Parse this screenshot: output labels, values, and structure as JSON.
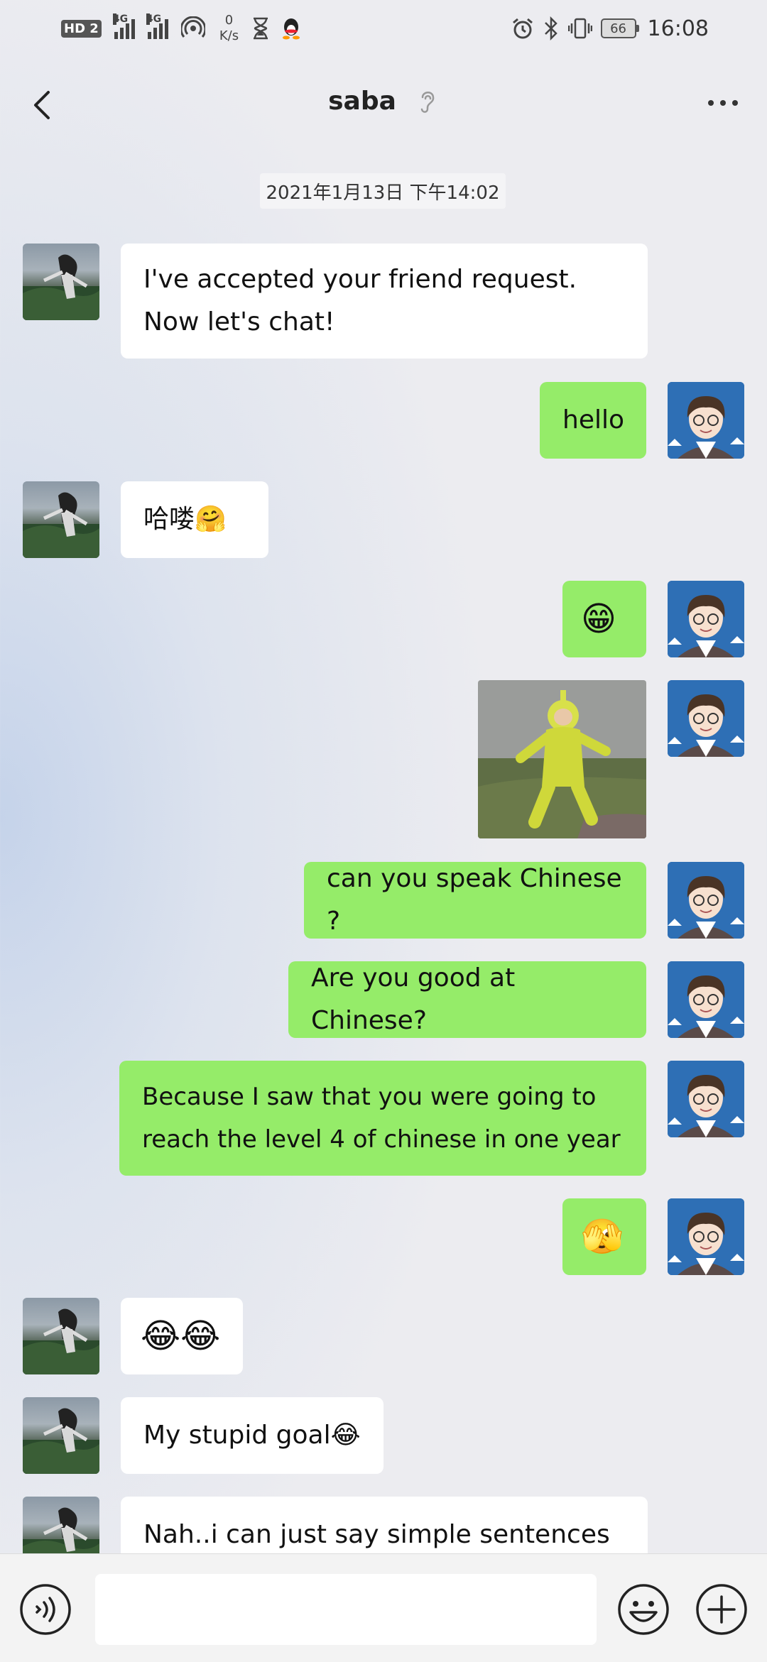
{
  "status_bar": {
    "hd_label": "HD",
    "hd_sim": "2",
    "net1": "4G",
    "net2": "4G",
    "speed_value": "0",
    "speed_unit": "K/s",
    "battery": "66",
    "time": "16:08"
  },
  "header": {
    "title": "saba"
  },
  "chat": {
    "timestamp": "2021年1月13日 下午14:02",
    "messages": [
      {
        "from": "friend",
        "text": "I've accepted your friend request. Now let's chat!"
      },
      {
        "from": "me",
        "text": "hello"
      },
      {
        "from": "friend",
        "text": "哈喽🤗"
      },
      {
        "from": "me",
        "text": "😁"
      },
      {
        "from": "me",
        "type": "image",
        "text": ""
      },
      {
        "from": "me",
        "text": "can you speak Chinese ?"
      },
      {
        "from": "me",
        "text": "Are you good at Chinese?"
      },
      {
        "from": "me",
        "text": "Because I saw that you were going to reach the level 4 of chinese in one year"
      },
      {
        "from": "me",
        "text": "🫣"
      },
      {
        "from": "friend",
        "text": "😂😂"
      },
      {
        "from": "friend",
        "text": "My stupid goal😂"
      },
      {
        "from": "friend",
        "text": "Nah..i can just say simple sentences"
      }
    ]
  },
  "input_bar": {
    "voice_icon": "voice-icon",
    "emoji_icon": "emoji-icon",
    "plus_icon": "plus-icon",
    "text_value": ""
  },
  "colors": {
    "outgoing_bubble": "#95ec69",
    "incoming_bubble": "#ffffff"
  }
}
